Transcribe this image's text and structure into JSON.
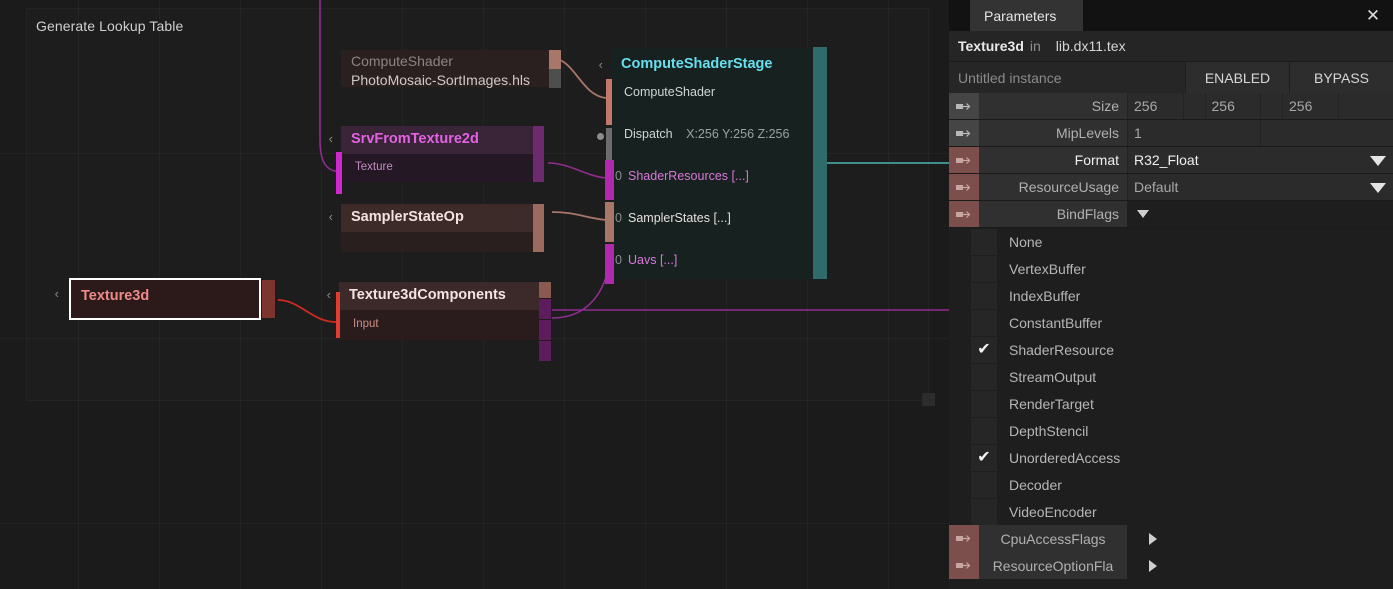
{
  "canvas": {
    "frame_title": "Generate Lookup Table",
    "nodes": {
      "compute_shader": {
        "type_label": "ComputeShader",
        "value_label": "PhotoMosaic-SortImages.hls"
      },
      "srv_from_texture2d": {
        "title": "SrvFromTexture2d",
        "chevron": "‹",
        "input_label": "Texture"
      },
      "sampler_state_op": {
        "title": "SamplerStateOp",
        "chevron": "‹"
      },
      "texture3d": {
        "title": "Texture3d",
        "chevron": "‹"
      },
      "texture3d_components": {
        "title": "Texture3dComponents",
        "chevron": "‹",
        "input_label": "Input"
      },
      "compute_shader_stage": {
        "title": "ComputeShaderStage",
        "chevron": "‹",
        "rows": [
          {
            "label": "ComputeShader",
            "value": ""
          },
          {
            "label": "Dispatch",
            "value": "X:256 Y:256 Z:256"
          }
        ],
        "list_rows": [
          {
            "count": "0",
            "label": "ShaderResources [...]"
          },
          {
            "count": "0",
            "label": "SamplerStates [...]"
          },
          {
            "count": "0",
            "label": "Uavs [...]"
          }
        ]
      }
    }
  },
  "panel": {
    "tab_label": "Parameters",
    "close_glyph": "✕",
    "identity": {
      "type": "Texture3d",
      "in_word": "in",
      "file": "lib.dx11.tex"
    },
    "instance": {
      "name_placeholder": "Untitled instance",
      "enabled_label": "ENABLED",
      "bypass_label": "BYPASS"
    },
    "params": [
      {
        "label": "Size",
        "values": [
          "256",
          "256",
          "256"
        ],
        "icon": "link-out-icon",
        "icon_tone": "gray",
        "kind": "multi"
      },
      {
        "label": "MipLevels",
        "values": [
          "1"
        ],
        "icon": "link-out-icon",
        "icon_tone": "gray",
        "kind": "single"
      },
      {
        "label": "Format",
        "value": "R32_Float",
        "icon": "link-out-icon",
        "icon_tone": "red",
        "kind": "dropdown",
        "highlight": true
      },
      {
        "label": "ResourceUsage",
        "value": "Default",
        "icon": "link-out-icon",
        "icon_tone": "red",
        "kind": "dropdown",
        "highlight": false
      },
      {
        "label": "BindFlags",
        "value": "",
        "icon": "link-out-icon",
        "icon_tone": "red",
        "kind": "expander-down"
      }
    ],
    "bind_flags": [
      {
        "label": "None",
        "checked": false
      },
      {
        "label": "VertexBuffer",
        "checked": false
      },
      {
        "label": "IndexBuffer",
        "checked": false
      },
      {
        "label": "ConstantBuffer",
        "checked": false
      },
      {
        "label": "ShaderResource",
        "checked": true
      },
      {
        "label": "StreamOutput",
        "checked": false
      },
      {
        "label": "RenderTarget",
        "checked": false
      },
      {
        "label": "DepthStencil",
        "checked": false
      },
      {
        "label": "UnorderedAccess",
        "checked": true
      },
      {
        "label": "Decoder",
        "checked": false
      },
      {
        "label": "VideoEncoder",
        "checked": false
      }
    ],
    "sub_params": [
      {
        "label": "CpuAccessFlags",
        "icon": "link-out-icon",
        "icon_tone": "red",
        "kind": "expander-right"
      },
      {
        "label": "ResourceOptionFla",
        "icon": "link-out-icon",
        "icon_tone": "red",
        "kind": "expander-right"
      }
    ],
    "check_glyph": "✔"
  },
  "colors": {
    "accent_cyan": "#66dff0",
    "accent_magenta": "#e362e3",
    "accent_red": "#ef8a8a",
    "panel_bg": "#1e1e1e",
    "canvas_bg": "#1b1b1b"
  }
}
